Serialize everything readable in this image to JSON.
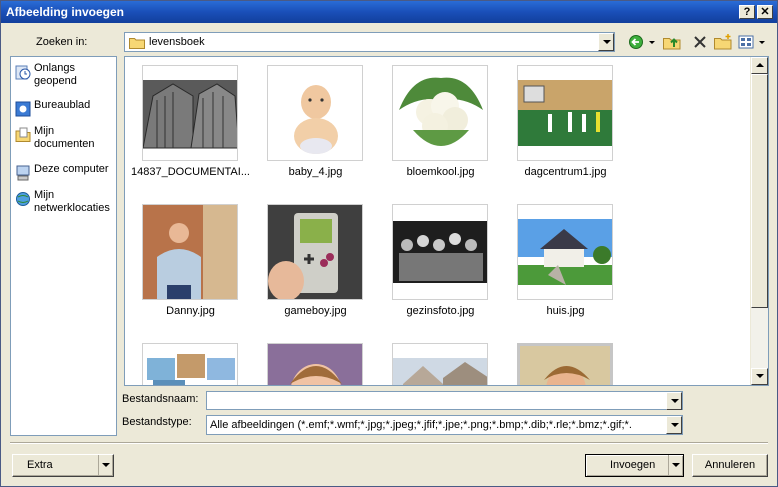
{
  "window": {
    "title": "Afbeelding invoegen",
    "help_glyph": "?",
    "close_glyph": "✕"
  },
  "lookin": {
    "label": "Zoeken in:",
    "value": "levensboek"
  },
  "places": [
    {
      "label": "Onlangs geopend",
      "icon": "recent-icon"
    },
    {
      "label": "Bureaublad",
      "icon": "desktop-icon"
    },
    {
      "label": "Mijn documenten",
      "icon": "my-documents-icon"
    },
    {
      "label": "Deze computer",
      "icon": "my-computer-icon"
    },
    {
      "label": "Mijn netwerklocaties",
      "icon": "network-places-icon"
    }
  ],
  "files": [
    {
      "name": "14837_DOCUMENTAI..."
    },
    {
      "name": "baby_4.jpg"
    },
    {
      "name": "bloemkool.jpg"
    },
    {
      "name": "dagcentrum1.jpg"
    },
    {
      "name": "Danny.jpg"
    },
    {
      "name": "gameboy.jpg"
    },
    {
      "name": "gezinsfoto.jpg"
    },
    {
      "name": "huis.jpg"
    },
    {
      "name": ""
    },
    {
      "name": ""
    },
    {
      "name": ""
    },
    {
      "name": ""
    }
  ],
  "form": {
    "filename_label": "Bestandsnaam:",
    "filename_value": "",
    "filetype_label": "Bestandstype:",
    "filetype_value": "Alle afbeeldingen (*.emf;*.wmf;*.jpg;*.jpeg;*.jfif;*.jpe;*.png;*.bmp;*.dib;*.rle;*.bmz;*.gif;*."
  },
  "buttons": {
    "extra": "Extra",
    "insert": "Invoegen",
    "cancel": "Annuleren"
  },
  "colors": {
    "titlebar": "#1a4fb8",
    "dialog_bg": "#ece9d8",
    "field_border": "#7f9db9"
  }
}
